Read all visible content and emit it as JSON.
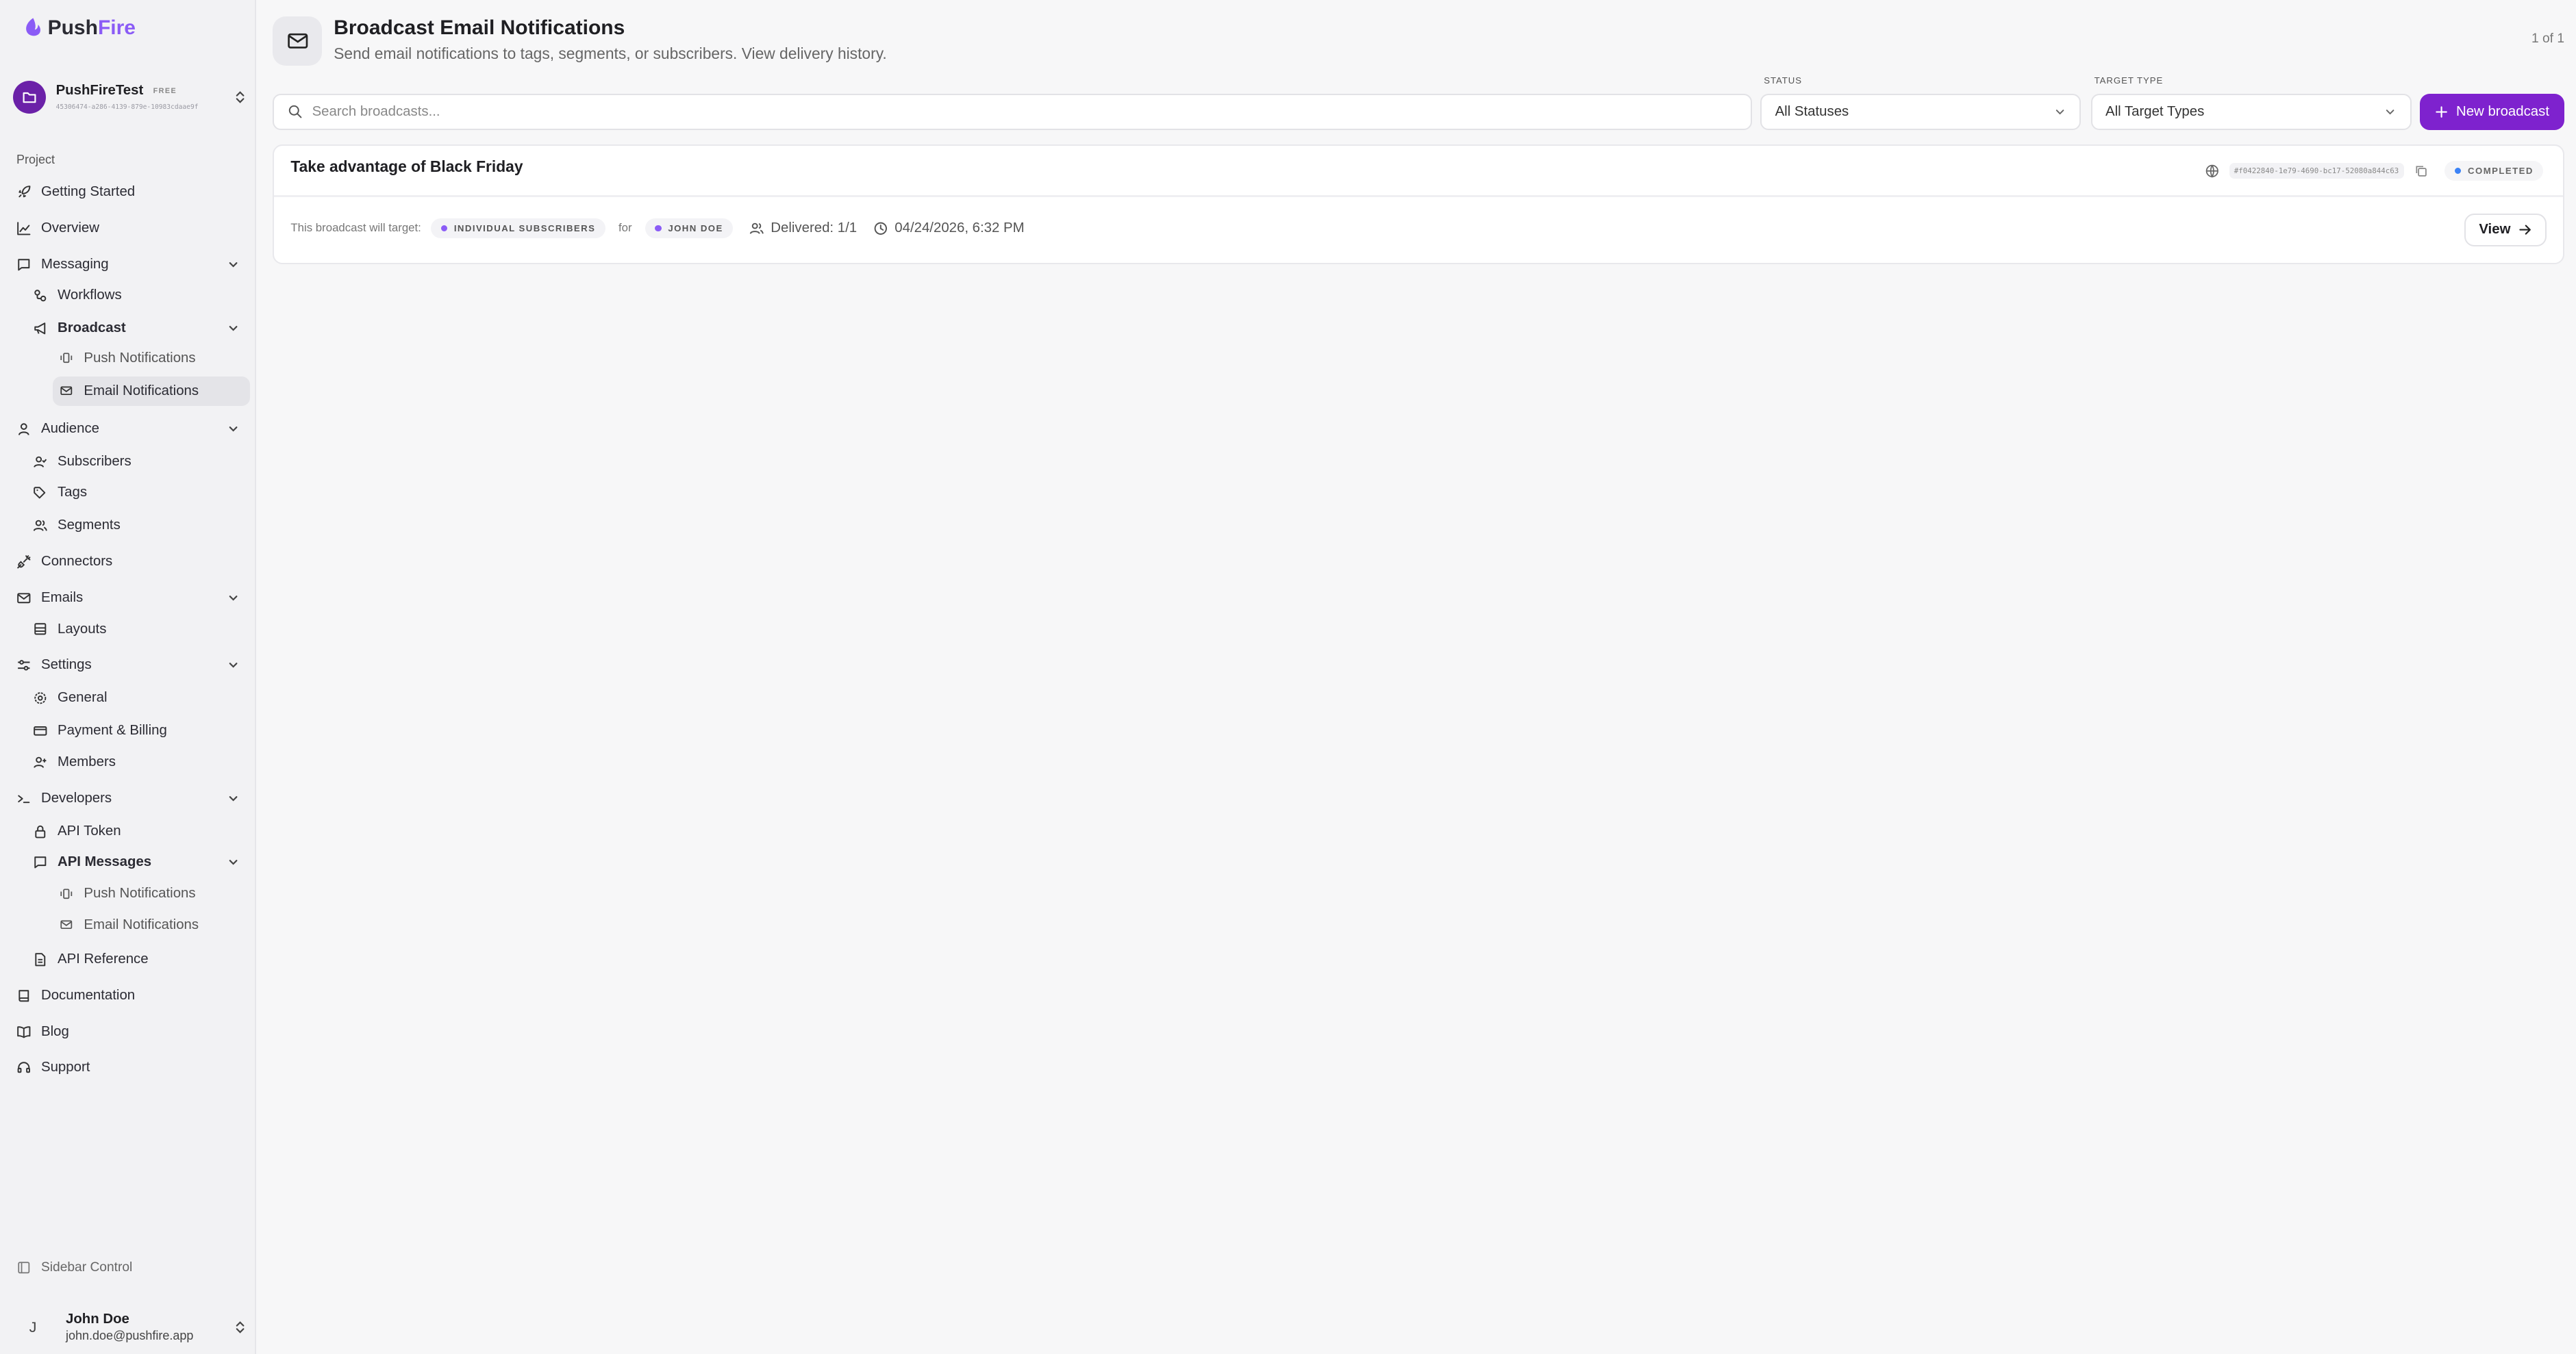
{
  "brand": {
    "name_part1": "Push",
    "name_part2": "Fire",
    "accent_color": "#8b5cf6"
  },
  "project": {
    "name": "PushFireTest",
    "plan": "FREE",
    "id": "45306474-a286-4139-879e-10983cdaae9f"
  },
  "sidebar": {
    "section_label": "Project",
    "items": {
      "getting_started": "Getting Started",
      "overview": "Overview",
      "messaging": "Messaging",
      "workflows": "Workflows",
      "broadcast": "Broadcast",
      "broadcast_push": "Push Notifications",
      "broadcast_email": "Email Notifications",
      "audience": "Audience",
      "subscribers": "Subscribers",
      "tags": "Tags",
      "segments": "Segments",
      "connectors": "Connectors",
      "emails": "Emails",
      "layouts": "Layouts",
      "settings": "Settings",
      "general": "General",
      "payment": "Payment & Billing",
      "members": "Members",
      "developers": "Developers",
      "api_token": "API Token",
      "api_messages": "API Messages",
      "api_push": "Push Notifications",
      "api_email": "Email Notifications",
      "api_reference": "API Reference",
      "documentation": "Documentation",
      "blog": "Blog",
      "support": "Support"
    },
    "sidebar_control": "Sidebar Control",
    "user": {
      "initial": "J",
      "name": "John Doe",
      "email": "john.doe@pushfire.app"
    }
  },
  "header": {
    "title": "Broadcast Email Notifications",
    "subtitle": "Send email notifications to tags, segments, or subscribers. View delivery history.",
    "pager": "1 of 1"
  },
  "filters": {
    "search_placeholder": "Search broadcasts...",
    "status_label": "STATUS",
    "status_value": "All Statuses",
    "target_label": "TARGET TYPE",
    "target_value": "All Target Types",
    "new_button": "New broadcast",
    "primary_color": "#7e22ce"
  },
  "broadcasts": [
    {
      "title": "Take advantage of Black Friday",
      "id": "#f0422840-1e79-4690-bc17-52080a844c63",
      "status": "COMPLETED",
      "target_prefix": "This broadcast will target:",
      "target_type": "INDIVIDUAL SUBSCRIBERS",
      "for_label": "for",
      "target_name": "JOHN DOE",
      "delivered": "Delivered: 1/1",
      "date": "04/24/2026, 6:32 PM",
      "view_label": "View"
    }
  ]
}
